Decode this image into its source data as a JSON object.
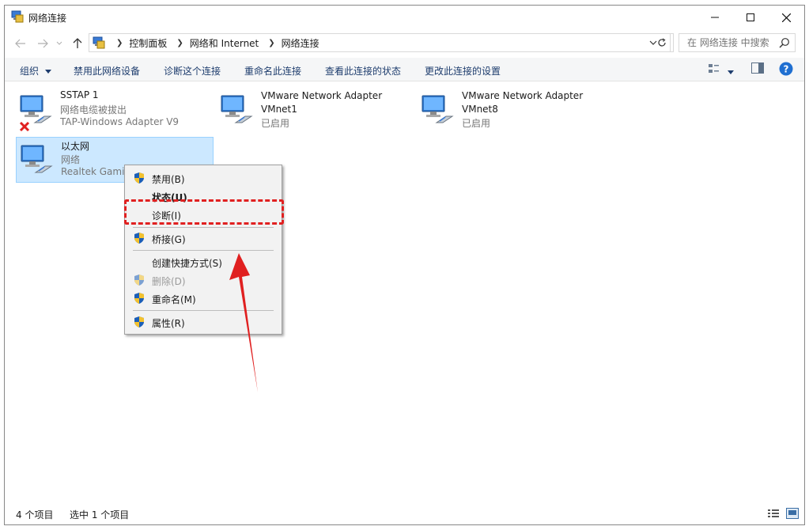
{
  "window": {
    "title": "网络连接",
    "controls": {
      "minimize": "minimize-icon",
      "maximize": "maximize-icon",
      "close": "close-icon"
    }
  },
  "address": {
    "crumbs": [
      "控制面板",
      "网络和 Internet",
      "网络连接"
    ],
    "search_placeholder": "在 网络连接 中搜索"
  },
  "toolbar": {
    "organize": "组织",
    "disable": "禁用此网络设备",
    "diagnose": "诊断这个连接",
    "rename": "重命名此连接",
    "view_status": "查看此连接的状态",
    "change_settings": "更改此连接的设置"
  },
  "connections": [
    {
      "name": "SSTAP 1",
      "status": "网络电缆被拔出",
      "adapter": "TAP-Windows Adapter V9",
      "error": true
    },
    {
      "name": "VMware Network Adapter VMnet1",
      "status": "已启用"
    },
    {
      "name": "VMware Network Adapter VMnet8",
      "status": "已启用"
    },
    {
      "name": "以太网",
      "status": "网络",
      "adapter": "Realtek Gamin",
      "selected": true
    }
  ],
  "context_menu": {
    "items": [
      {
        "label": "禁用(B)",
        "shield": true
      },
      {
        "label": "状态(U)",
        "bold": true
      },
      {
        "label": "诊断(I)",
        "highlighted": true
      },
      {
        "label": "桥接(G)",
        "shield": true
      },
      {
        "label": "创建快捷方式(S)"
      },
      {
        "label": "删除(D)",
        "shield": true,
        "disabled": true
      },
      {
        "label": "重命名(M)",
        "shield": true
      },
      {
        "label": "属性(R)",
        "shield": true
      }
    ]
  },
  "statusbar": {
    "item_count": "4 个项目",
    "selected_count": "选中 1 个项目"
  },
  "colors": {
    "annotation_red": "#e02020",
    "selection_bg": "#cce8ff",
    "command_text": "#1e3d6e",
    "help_blue": "#1f6fd1"
  }
}
